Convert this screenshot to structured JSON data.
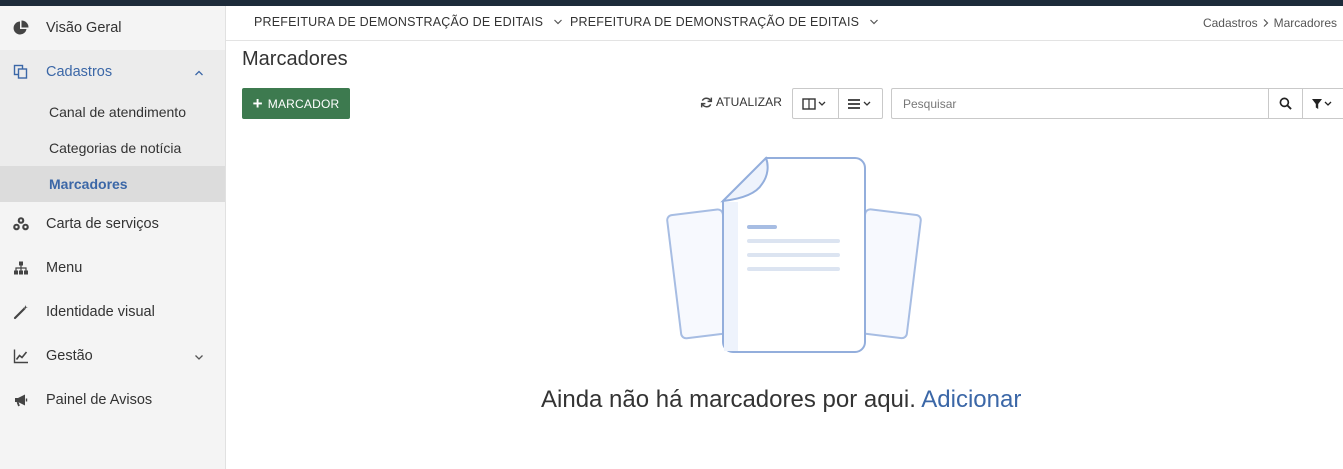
{
  "sidebar": {
    "items": [
      {
        "label": "Visão Geral",
        "icon": "pie-chart-icon"
      },
      {
        "label": "Cadastros",
        "icon": "copy-icon",
        "expanded": true,
        "children": [
          {
            "label": "Canal de atendimento"
          },
          {
            "label": "Categorias de notícia"
          },
          {
            "label": "Marcadores",
            "selected": true
          }
        ]
      },
      {
        "label": "Carta de serviços",
        "icon": "cubes-icon"
      },
      {
        "label": "Menu",
        "icon": "sitemap-icon"
      },
      {
        "label": "Identidade visual",
        "icon": "magic-wand-icon"
      },
      {
        "label": "Gestão",
        "icon": "line-chart-icon",
        "expanded": false
      },
      {
        "label": "Painel de Avisos",
        "icon": "bullhorn-icon"
      }
    ]
  },
  "header": {
    "org_selectors": [
      "PREFEITURA DE DEMONSTRAÇÃO DE EDITAIS",
      "PREFEITURA DE DEMONSTRAÇÃO DE EDITAIS"
    ],
    "breadcrumb": [
      "Cadastros",
      "Marcadores"
    ]
  },
  "main": {
    "title": "Marcadores",
    "add_button": "MARCADOR",
    "refresh_button": "ATUALIZAR",
    "search_placeholder": "Pesquisar",
    "empty_text": "Ainda não há marcadores por aqui.",
    "empty_link": "Adicionar"
  },
  "colors": {
    "accent": "#3b67a7",
    "add_button": "#3d7a4f",
    "top_strip": "#1d2b3a"
  }
}
